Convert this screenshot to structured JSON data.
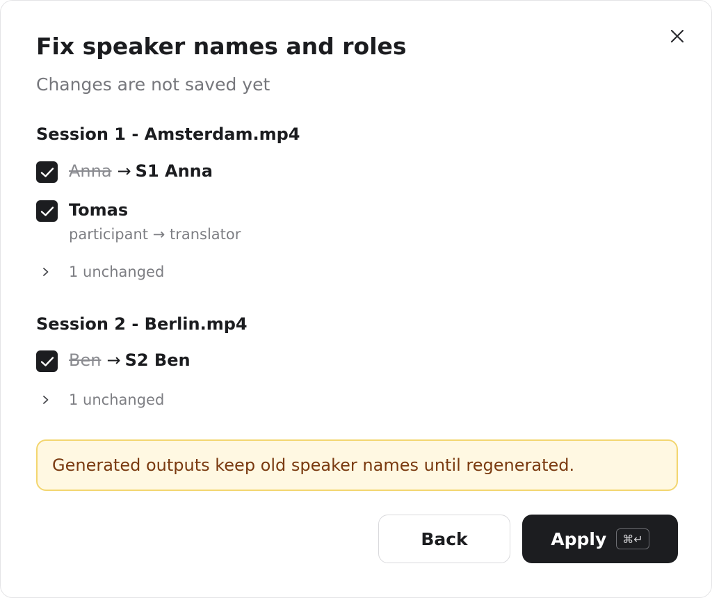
{
  "dialog": {
    "title": "Fix speaker names and roles",
    "subtitle": "Changes are not saved yet"
  },
  "sessions": [
    {
      "heading": "Session 1 - Amsterdam.mp4",
      "changes": [
        {
          "type": "rename",
          "checked": true,
          "old": "Anna",
          "arrow": "→",
          "new": "S1 Anna"
        },
        {
          "type": "role",
          "checked": true,
          "name": "Tomas",
          "role_change": "participant → translator"
        }
      ],
      "unchanged_label": "1 unchanged"
    },
    {
      "heading": "Session 2 - Berlin.mp4",
      "changes": [
        {
          "type": "rename",
          "checked": true,
          "old": "Ben",
          "arrow": "→",
          "new": "S2 Ben"
        }
      ],
      "unchanged_label": "1 unchanged"
    }
  ],
  "notice": "Generated outputs keep old speaker names until regenerated.",
  "actions": {
    "back_label": "Back",
    "apply_label": "Apply",
    "apply_shortcut": "⌘↵"
  },
  "icons": {
    "close": "close-icon",
    "check": "checkmark-icon",
    "chevron": "chevron-right-icon",
    "command": "command-key-icon",
    "enter": "enter-key-icon"
  },
  "colors": {
    "primary": "#1c1d20",
    "muted_text": "#7d7e83",
    "notice_bg": "#fff8e2",
    "notice_border": "#f3d670",
    "notice_text": "#7a3a10"
  }
}
